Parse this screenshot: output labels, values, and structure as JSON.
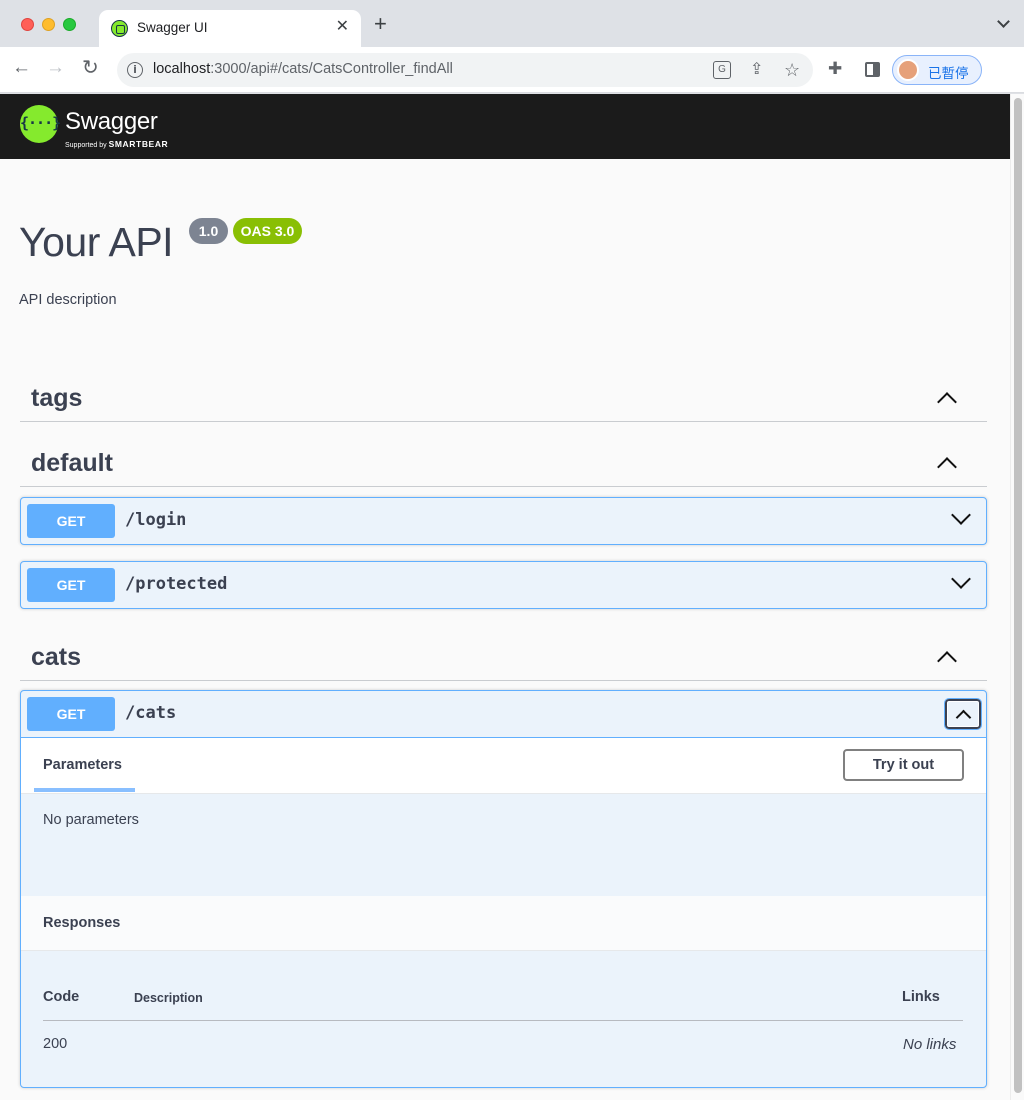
{
  "browser": {
    "tab_title": "Swagger UI",
    "tab_close": "✕",
    "new_tab": "+",
    "url_host": "localhost",
    "url_rest": ":3000/api#/cats/CatsController_findAll",
    "profile_label": "已暫停",
    "icons": [
      "back-icon",
      "forward-icon",
      "reload-icon",
      "info-icon",
      "translate-icon",
      "share-icon",
      "star-icon",
      "extensions-icon",
      "side-panel-icon",
      "avatar"
    ]
  },
  "header": {
    "logo_glyph": "{···}",
    "logo_text": "Swagger",
    "logo_sub_prefix": "Supported by ",
    "logo_sub_brand": "SMARTBEAR"
  },
  "info": {
    "title": "Your API",
    "version": "1.0",
    "oas": "OAS 3.0",
    "description": "API description"
  },
  "sections": [
    {
      "name": "tags"
    },
    {
      "name": "default"
    },
    {
      "name": "cats"
    }
  ],
  "operations": [
    {
      "method": "GET",
      "path": "/login",
      "expanded": false
    },
    {
      "method": "GET",
      "path": "/protected",
      "expanded": false
    },
    {
      "method": "GET",
      "path": "/cats",
      "expanded": true
    }
  ],
  "cats_op": {
    "tab_parameters": "Parameters",
    "try_it_out": "Try it out",
    "no_parameters": "No parameters",
    "responses_title": "Responses",
    "columns": {
      "code": "Code",
      "description": "Description",
      "links": "Links"
    },
    "rows": [
      {
        "code": "200",
        "description": "",
        "links": "No links"
      }
    ]
  },
  "colors": {
    "get_method": "#61affe",
    "opblock_bg": "#ebf3fb",
    "topbar": "#1b1b1b",
    "logo_green": "#85ea2d",
    "badge_version": "#7d8492",
    "badge_oas": "#89bf04"
  }
}
